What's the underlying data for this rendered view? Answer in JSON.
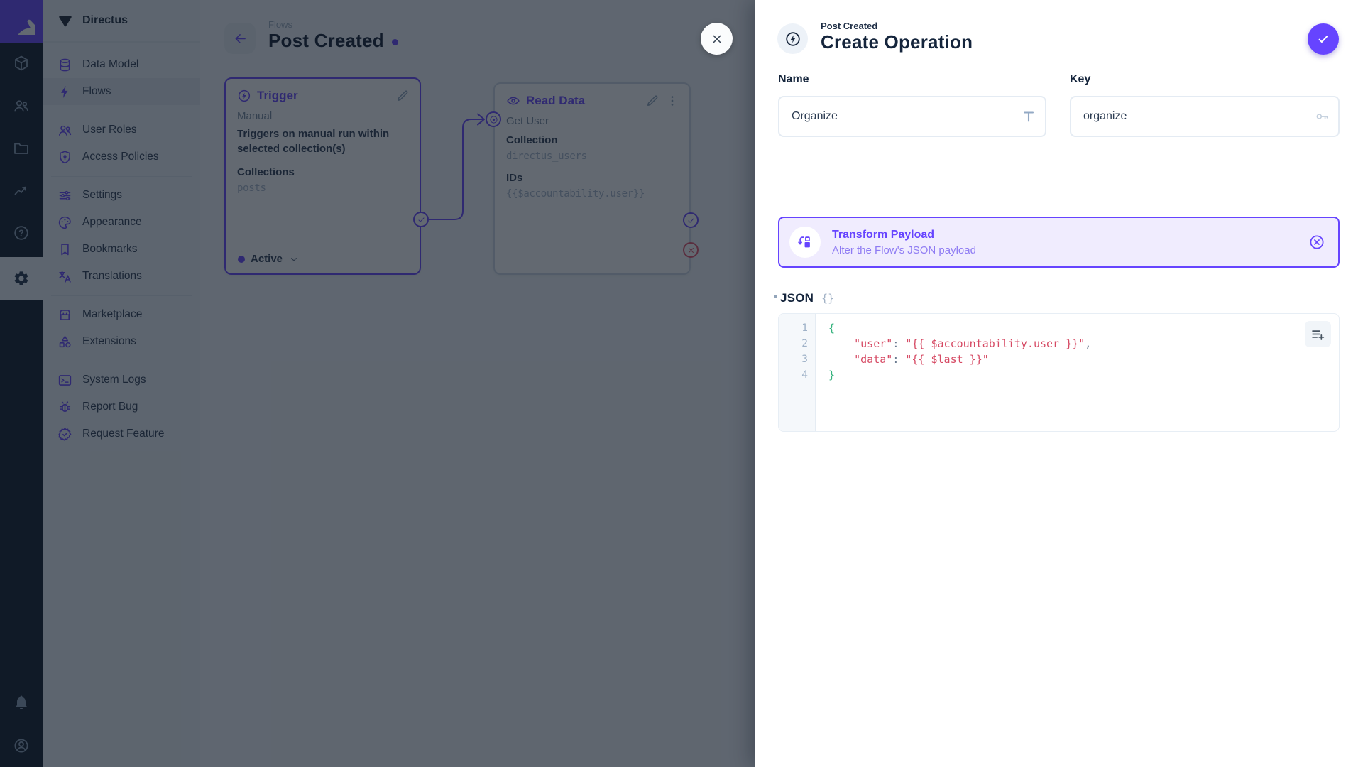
{
  "colors": {
    "brand": "#6644ff",
    "danger": "#e35169",
    "code_string": "#d64a64",
    "code_brace": "#35b27d",
    "banner_bg": "#f0ecfe"
  },
  "module_bar": {
    "modules": [
      {
        "name": "content",
        "icon": "box"
      },
      {
        "name": "users",
        "icon": "users"
      },
      {
        "name": "files",
        "icon": "folder"
      },
      {
        "name": "insights",
        "icon": "insights"
      },
      {
        "name": "docs",
        "icon": "help"
      },
      {
        "name": "settings",
        "icon": "gear",
        "active": true
      }
    ]
  },
  "nav": {
    "project_name": "Directus",
    "sections": [
      {
        "items": [
          {
            "label": "Data Model",
            "icon": "database"
          },
          {
            "label": "Flows",
            "icon": "bolt",
            "active": true
          }
        ]
      },
      {
        "items": [
          {
            "label": "User Roles",
            "icon": "users"
          },
          {
            "label": "Access Policies",
            "icon": "shield"
          }
        ]
      },
      {
        "items": [
          {
            "label": "Settings",
            "icon": "tune"
          },
          {
            "label": "Appearance",
            "icon": "palette"
          },
          {
            "label": "Bookmarks",
            "icon": "bookmark"
          },
          {
            "label": "Translations",
            "icon": "translate"
          }
        ]
      },
      {
        "items": [
          {
            "label": "Marketplace",
            "icon": "storefront"
          },
          {
            "label": "Extensions",
            "icon": "extensions"
          }
        ]
      },
      {
        "items": [
          {
            "label": "System Logs",
            "icon": "terminal"
          },
          {
            "label": "Report Bug",
            "icon": "bug"
          },
          {
            "label": "Request Feature",
            "icon": "feature"
          }
        ]
      }
    ]
  },
  "canvas": {
    "breadcrumb": "Flows",
    "title": "Post Created",
    "trigger_panel": {
      "title": "Trigger",
      "type": "Manual",
      "description": "Triggers on manual run within selected collection(s)",
      "field_label": "Collections",
      "field_value": "posts",
      "status": "Active"
    },
    "read_panel": {
      "title": "Read Data",
      "name": "Get User",
      "field1_label": "Collection",
      "field1_value": "directus_users",
      "field2_label": "IDs",
      "field2_value": "{{$accountability.user}}"
    }
  },
  "drawer": {
    "breadcrumb": "Post Created",
    "title": "Create Operation",
    "name_field": {
      "label": "Name",
      "value": "Organize"
    },
    "key_field": {
      "label": "Key",
      "value": "organize"
    },
    "operation_banner": {
      "title": "Transform Payload",
      "subtitle": "Alter the Flow's JSON payload"
    },
    "json_editor": {
      "label": "JSON",
      "icon_label": "{}",
      "lines": [
        {
          "n": "1",
          "tokens": [
            {
              "c": "b",
              "t": "{"
            }
          ]
        },
        {
          "n": "2",
          "tokens": [
            {
              "c": "s",
              "t": "    \"user\""
            },
            {
              "c": "p",
              "t": ": "
            },
            {
              "c": "s",
              "t": "\"{{ $accountability.user }}\""
            },
            {
              "c": "p",
              "t": ","
            }
          ]
        },
        {
          "n": "3",
          "tokens": [
            {
              "c": "s",
              "t": "    \"data\""
            },
            {
              "c": "p",
              "t": ": "
            },
            {
              "c": "s",
              "t": "\"{{ $last }}\""
            }
          ]
        },
        {
          "n": "4",
          "tokens": [
            {
              "c": "b",
              "t": "}"
            }
          ]
        }
      ]
    }
  }
}
